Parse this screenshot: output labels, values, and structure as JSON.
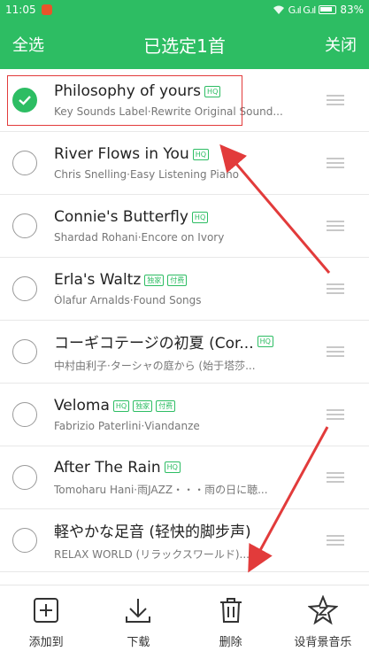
{
  "status_bar": {
    "time": "11:05",
    "signal_text": "G.ıl G.ıl",
    "battery": "83%"
  },
  "header": {
    "select_all": "全选",
    "title": "已选定1首",
    "close": "关闭",
    "background_color": "#2dbd63"
  },
  "songs": [
    {
      "title": "Philosophy of yours",
      "badges": [
        "HQ"
      ],
      "subtitle": "Key Sounds Label·Rewrite Original Sound...",
      "checked": true
    },
    {
      "title": "River Flows in You",
      "badges": [
        "HQ"
      ],
      "subtitle": "Chris Snelling·Easy Listening Piano",
      "checked": false
    },
    {
      "title": "Connie's Butterfly",
      "badges": [
        "HQ"
      ],
      "subtitle": "Shardad Rohani·Encore on Ivory",
      "checked": false
    },
    {
      "title": "Erla's Waltz",
      "badges": [
        "独家",
        "付费"
      ],
      "subtitle": "Ólafur Arnalds·Found Songs",
      "checked": false
    },
    {
      "title": "コーギコテージの初夏 (Cor...",
      "badges": [
        "HQ"
      ],
      "subtitle": "中村由利子·ターシャの庭から (始于塔莎...",
      "checked": false
    },
    {
      "title": "Veloma",
      "badges": [
        "HQ",
        "独家",
        "付费"
      ],
      "subtitle": "Fabrizio Paterlini·Viandanze",
      "checked": false
    },
    {
      "title": "After The Rain",
      "badges": [
        "HQ"
      ],
      "subtitle": "Tomoharu Hani·雨JAZZ・・・雨の日に聴...",
      "checked": false
    },
    {
      "title": "軽やかな足音 (轻快的脚步声)",
      "badges": [],
      "subtitle": "RELAX WORLD (リラックスワールド)...",
      "checked": false
    }
  ],
  "actions": [
    {
      "label": "添加到",
      "icon": "add-square-icon"
    },
    {
      "label": "下载",
      "icon": "download-icon"
    },
    {
      "label": "删除",
      "icon": "trash-icon"
    },
    {
      "label": "设背景音乐",
      "icon": "star-z-icon"
    }
  ],
  "colors": {
    "accent": "#2dbd63",
    "annotation_red": "#e23b3b"
  }
}
